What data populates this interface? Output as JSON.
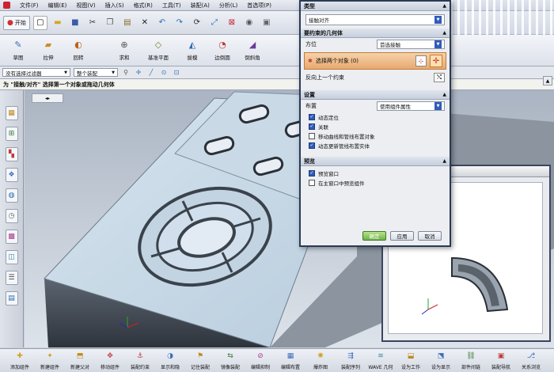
{
  "menubar": {
    "items": [
      "文件(F)",
      "编辑(E)",
      "视图(V)",
      "插入(S)",
      "格式(R)",
      "工具(T)",
      "装配(A)",
      "分析(L)",
      "首选项(P)"
    ]
  },
  "toolbar1": {
    "start_label": "开始"
  },
  "toolbar2": {
    "tools": [
      "草图",
      "拉伸",
      "回转",
      "求和",
      "基准平面",
      "拔模",
      "边倒圆",
      "倒斜角"
    ]
  },
  "filterbar": {
    "filter_value": "没有选择过滤器",
    "assembly_value": "整个装配"
  },
  "cue_line": "为 \"接触/对齐\" 选择第一个对象或拖动几何体",
  "bottombar": {
    "tools": [
      "添加组件",
      "新建组件",
      "新建父对",
      "移动组件",
      "装配约束",
      "显示和隐",
      "记住装配",
      "镜像装配",
      "编辑抑制",
      "编辑布置",
      "爆炸图",
      "装配序列",
      "WAVE 几何",
      "设为工作",
      "设为显示",
      "部件间链",
      "装配导航",
      "关系浏览"
    ]
  },
  "dialog": {
    "type_header": "类型",
    "type_value": "接触对齐",
    "geometry_header": "要约束的几何体",
    "orient_label": "方位",
    "orient_value": "首选接触",
    "select_label": "选择两个对象 (0)",
    "reverse_label": "反向上一个约束",
    "settings_header": "设置",
    "layout_label": "布置",
    "layout_value": "使用组件属性",
    "checks": [
      {
        "label": "动态定位",
        "checked": true
      },
      {
        "label": "关联",
        "checked": true
      },
      {
        "label": "移动曲线和管线布置对象",
        "checked": false
      },
      {
        "label": "动态更新管线布置实体",
        "checked": true
      }
    ],
    "preview_header": "预览",
    "preview_checks": [
      {
        "label": "预览窗口",
        "checked": true
      },
      {
        "label": "在主窗口中预览组件",
        "checked": false
      }
    ],
    "ok_label": "确定",
    "apply_label": "应用",
    "cancel_label": "取消"
  }
}
